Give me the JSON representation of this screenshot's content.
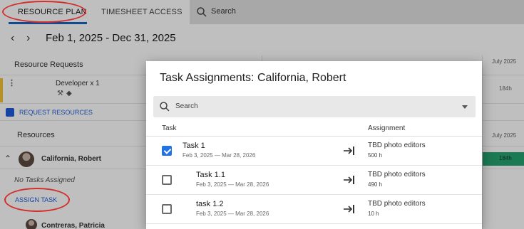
{
  "tabs": {
    "resource_plan": "RESOURCE PLAN",
    "timesheet_access": "TIMESHEET ACCESS"
  },
  "search": {
    "label": "Search"
  },
  "planner": {
    "date_range": "Feb 1, 2025 - Dec 31, 2025",
    "resource_requests_label": "Resource Requests",
    "month_header": "July 2025",
    "request_row": {
      "role": "Developer x 1",
      "hours": "184h"
    },
    "request_resources_label": "REQUEST RESOURCES",
    "resources_label": "Resources",
    "resource_1": {
      "name": "California, Robert",
      "hours": "184h"
    },
    "no_tasks_label": "No Tasks Assigned",
    "assign_task_label": "ASSIGN TASK",
    "resource_2": {
      "name": "Contreras, Patricia"
    }
  },
  "modal": {
    "title": "Task Assignments: California, Robert",
    "search_label": "Search",
    "col_task": "Task",
    "col_assignment": "Assignment",
    "rows": [
      {
        "name": "Task 1",
        "dates": "Feb 3, 2025 — Mar 28, 2026",
        "assignment": "TBD photo editors",
        "hours": "500 h",
        "checked": true
      },
      {
        "name": "Task 1.1",
        "dates": "Feb 3, 2025 — Mar 28, 2026",
        "assignment": "TBD photo editors",
        "hours": "490 h",
        "checked": false
      },
      {
        "name": "task 1.2",
        "dates": "Feb 3, 2025 — Mar 28, 2026",
        "assignment": "TBD photo editors",
        "hours": "10 h",
        "checked": false
      }
    ]
  },
  "colors": {
    "accent": "#1e73e8",
    "highlight": "#d32f2f",
    "bar": "#25a36f",
    "request_flag": "#f2c233"
  },
  "icons": [
    "search-icon",
    "chevron-left-icon",
    "chevron-right-icon",
    "dropdown-caret-icon",
    "assign-arrow-icon",
    "wrench-icon",
    "tag-icon",
    "person-add-icon",
    "chevron-up-icon",
    "more-vertical-icon"
  ]
}
